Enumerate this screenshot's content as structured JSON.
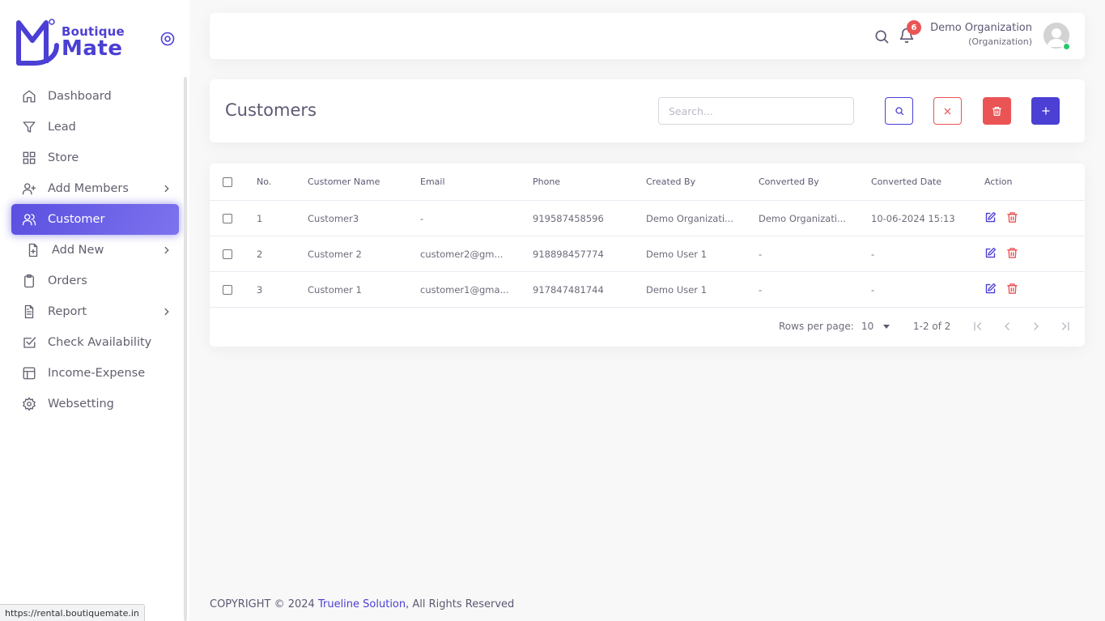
{
  "brand": {
    "line1": "Boutique",
    "line2": "Mate"
  },
  "sidebar": {
    "items": [
      {
        "label": "Dashboard",
        "icon": "home-icon"
      },
      {
        "label": "Lead",
        "icon": "filter-icon"
      },
      {
        "label": "Store",
        "icon": "grid-icon"
      },
      {
        "label": "Add Members",
        "icon": "user-plus-icon",
        "has_children": true
      },
      {
        "label": "Customer",
        "icon": "users-icon",
        "active": true
      },
      {
        "label": "Add New",
        "icon": "file-plus-icon",
        "has_children": true
      },
      {
        "label": "Orders",
        "icon": "clipboard-icon"
      },
      {
        "label": "Report",
        "icon": "file-text-icon",
        "has_children": true
      },
      {
        "label": "Check Availability",
        "icon": "check-square-icon"
      },
      {
        "label": "Income-Expense",
        "icon": "layout-icon"
      },
      {
        "label": "Websetting",
        "icon": "settings-icon"
      }
    ]
  },
  "topbar": {
    "notification_count": "6",
    "user_name": "Demo Organization",
    "user_role": "(Organization)"
  },
  "page": {
    "title": "Customers",
    "search_placeholder": "Search..."
  },
  "table": {
    "headers": {
      "no": "No.",
      "name": "Customer Name",
      "email": "Email",
      "phone": "Phone",
      "created_by": "Created By",
      "converted_by": "Converted By",
      "converted_date": "Converted Date",
      "action": "Action"
    },
    "rows": [
      {
        "no": "1",
        "name": "Customer3",
        "email": "-",
        "phone": "919587458596",
        "created_by": "Demo Organizati...",
        "converted_by": "Demo Organizati...",
        "converted_date": "10-06-2024 15:13"
      },
      {
        "no": "2",
        "name": "Customer 2",
        "email": "customer2@gm...",
        "phone": "918898457774",
        "created_by": "Demo User 1",
        "converted_by": "-",
        "converted_date": "-"
      },
      {
        "no": "3",
        "name": "Customer 1",
        "email": "customer1@gma...",
        "phone": "917847481744",
        "created_by": "Demo User 1",
        "converted_by": "-",
        "converted_date": "-"
      }
    ]
  },
  "pagination": {
    "rows_per_page_label": "Rows per page:",
    "rows_per_page": "10",
    "range": "1-2 of 2"
  },
  "footer": {
    "prefix": "COPYRIGHT © 2024 ",
    "company": "Trueline Solution",
    "suffix": ", All Rights Reserved"
  },
  "status_bar": {
    "url": "https://rental.boutiquemate.in"
  },
  "colors": {
    "primary": "#4b3fd4",
    "danger": "#ea5455",
    "success": "#28c76f"
  }
}
